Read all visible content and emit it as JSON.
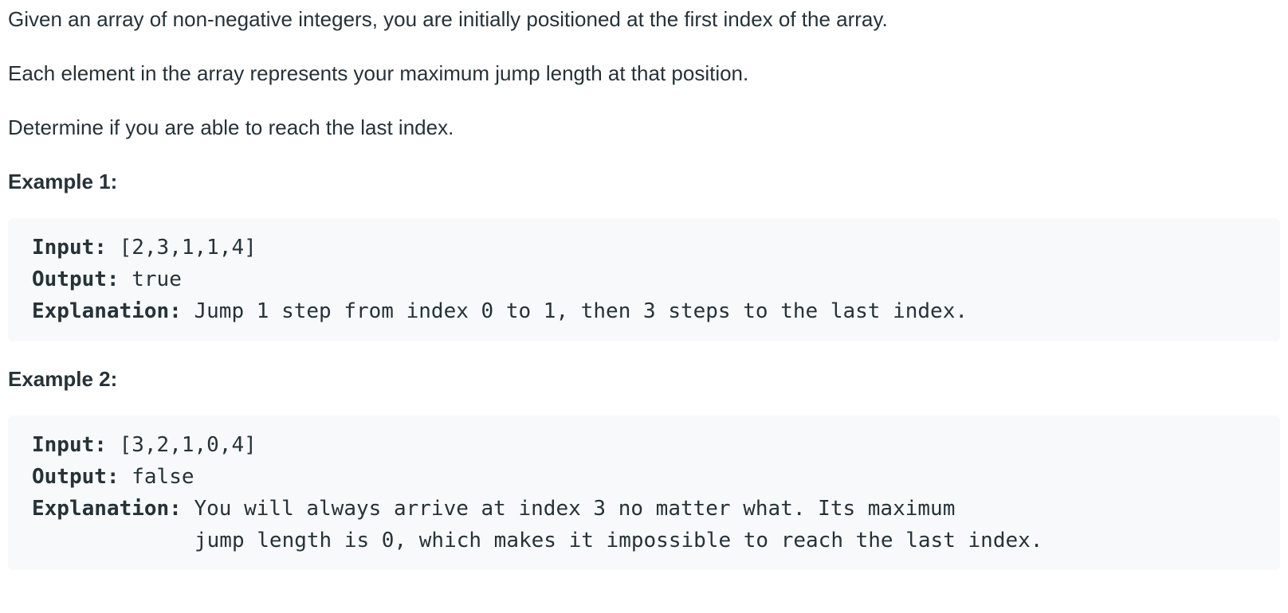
{
  "intro": {
    "line1": "Given an array of non-negative integers, you are initially positioned at the first index of the array.",
    "line2": "Each element in the array represents your maximum jump length at that position.",
    "line3": "Determine if you are able to reach the last index."
  },
  "example1": {
    "heading": "Example 1:",
    "input_label": "Input:",
    "input_value": " [2,3,1,1,4]",
    "output_label": "Output:",
    "output_value": " true",
    "explanation_label": "Explanation:",
    "explanation_value": " Jump 1 step from index 0 to 1, then 3 steps to the last index."
  },
  "example2": {
    "heading": "Example 2:",
    "input_label": "Input:",
    "input_value": " [3,2,1,0,4]",
    "output_label": "Output:",
    "output_value": " false",
    "explanation_label": "Explanation:",
    "explanation_value": " You will always arrive at index 3 no matter what. Its maximum",
    "explanation_cont": "jump length is 0, which makes it impossible to reach the last index."
  }
}
